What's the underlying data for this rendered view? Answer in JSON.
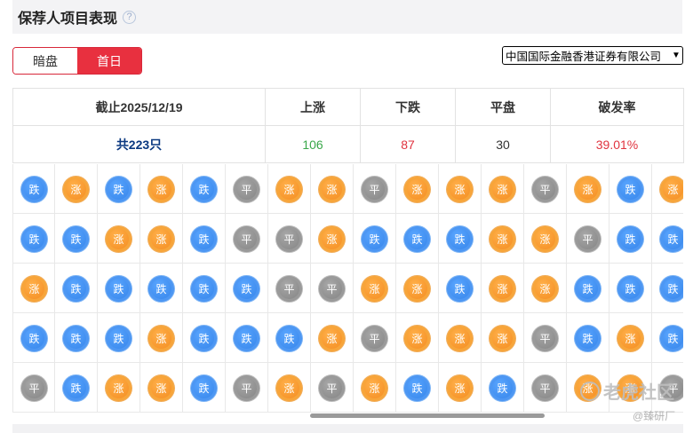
{
  "header": {
    "title": "保荐人项目表现",
    "help_icon": "?"
  },
  "toggle": {
    "options": [
      "暗盘",
      "首日"
    ],
    "active_index": 1
  },
  "sponsor_select": {
    "value": "中国国际金融香港证券有限公司",
    "icon": "chevron-down-icon"
  },
  "stats": {
    "headers": [
      "截止2025/12/19",
      "上涨",
      "下跌",
      "平盘",
      "破发率"
    ],
    "values": {
      "total": "共223只",
      "up": "106",
      "down": "87",
      "flat": "30",
      "break_rate": "39.01%"
    }
  },
  "legend_labels": {
    "up": "涨",
    "down": "跌",
    "flat": "平"
  },
  "grid_rows": [
    [
      "down",
      "up",
      "down",
      "up",
      "down",
      "flat",
      "up",
      "up",
      "flat",
      "up",
      "up",
      "up",
      "flat",
      "up",
      "down",
      "up"
    ],
    [
      "down",
      "down",
      "up",
      "up",
      "down",
      "flat",
      "flat",
      "up",
      "down",
      "down",
      "down",
      "up",
      "up",
      "flat",
      "down",
      "down"
    ],
    [
      "up",
      "down",
      "down",
      "down",
      "down",
      "down",
      "flat",
      "flat",
      "up",
      "up",
      "down",
      "up",
      "up",
      "down",
      "down",
      "down"
    ],
    [
      "down",
      "down",
      "down",
      "up",
      "down",
      "down",
      "down",
      "up",
      "flat",
      "up",
      "up",
      "up",
      "flat",
      "down",
      "up",
      "down"
    ],
    [
      "flat",
      "down",
      "up",
      "up",
      "down",
      "flat",
      "up",
      "flat",
      "up",
      "down",
      "up",
      "down",
      "flat",
      "up",
      "up",
      "flat"
    ]
  ],
  "colors": {
    "up": "#f2861a",
    "down": "#2f7fe6",
    "flat": "#8a8a8a",
    "accent": "#e8303f"
  },
  "watermark": {
    "text": "老虎社区",
    "sub": "@臻研厂"
  }
}
